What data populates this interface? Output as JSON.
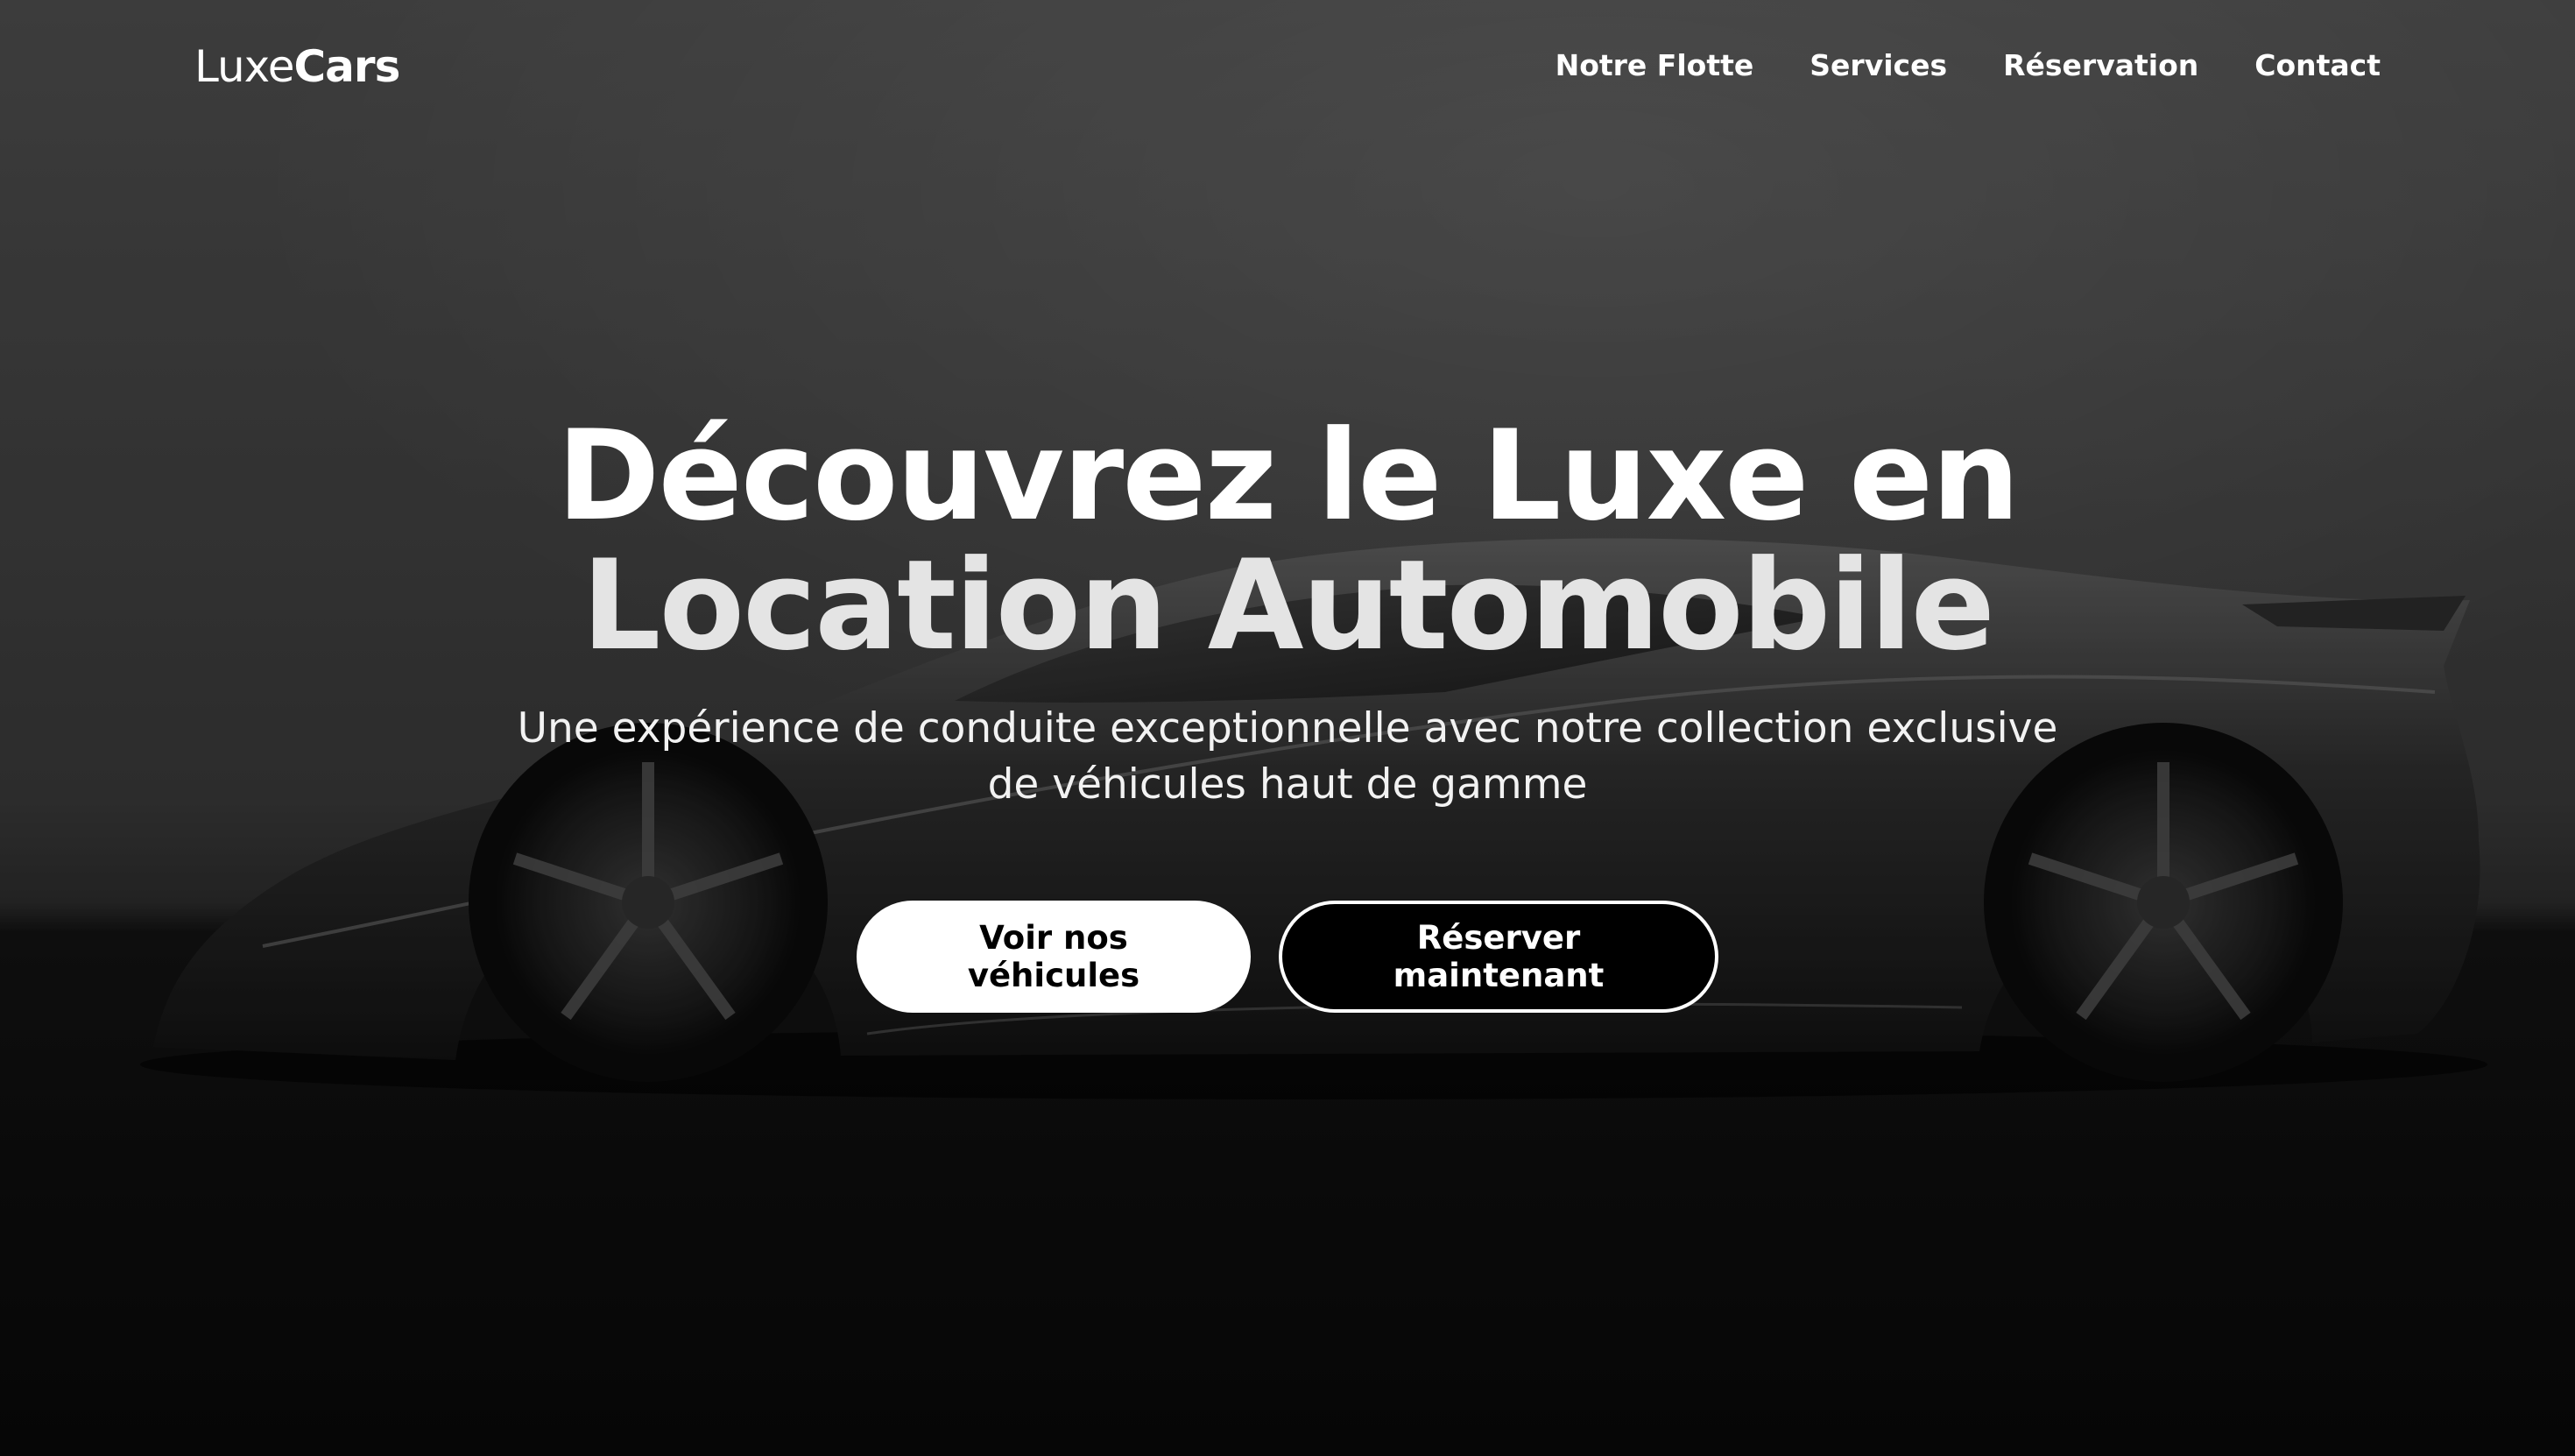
{
  "brand": {
    "light": "Luxe",
    "bold": "Cars"
  },
  "nav": {
    "items": [
      {
        "label": "Notre Flotte"
      },
      {
        "label": "Services"
      },
      {
        "label": "Réservation"
      },
      {
        "label": "Contact"
      }
    ]
  },
  "hero": {
    "title_line1": "Découvrez le Luxe en",
    "title_line2": "Location Automobile",
    "subtitle": "Une expérience de conduite exceptionnelle avec notre collection exclusive de véhicules haut de gamme",
    "primary_button": "Voir nos véhicules",
    "secondary_button": "Réserver maintenant",
    "background_image": "luxury-sports-car-photo"
  },
  "colors": {
    "text": "#ffffff",
    "primary_button_bg": "#ffffff",
    "primary_button_text": "#000000",
    "secondary_button_bg": "#000000",
    "secondary_button_text": "#ffffff"
  }
}
